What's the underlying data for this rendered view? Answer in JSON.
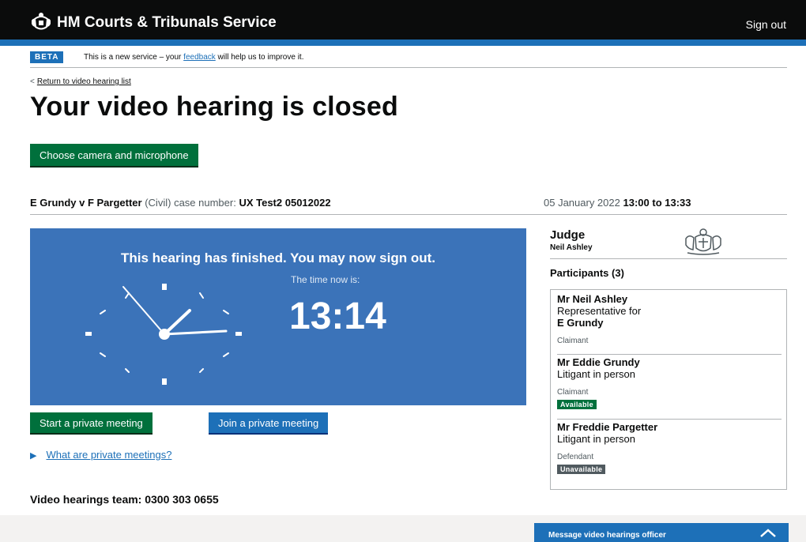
{
  "header": {
    "service_name": "HM Courts & Tribunals Service",
    "sign_out": "Sign out"
  },
  "banner": {
    "tag": "BETA",
    "text_before": "This is a new service – your ",
    "link": "feedback",
    "text_after": " will help us to improve it."
  },
  "nav": {
    "back_link": "Return to video hearing list"
  },
  "page": {
    "title": "Your video hearing is closed",
    "choose_devices_button": "Choose camera and microphone"
  },
  "case": {
    "parties": "E Grundy v F Pargetter",
    "case_type": "(Civil)",
    "case_number_label": "case number:",
    "case_number": "UX Test2 05012022",
    "date": "05 January 2022",
    "start_time": "13:00",
    "to": "to",
    "end_time": "13:33"
  },
  "clock": {
    "finished_message": "This hearing has finished. You may now sign out.",
    "time_label": "The time now is:",
    "time_value": "13:14"
  },
  "actions": {
    "start_private_meeting": "Start a private meeting",
    "join_private_meeting": "Join a private meeting",
    "private_meetings_link": "What are private meetings?"
  },
  "contact": {
    "text": "Video hearings team: 0300 303 0655"
  },
  "judge": {
    "title": "Judge",
    "name": "Neil Ashley"
  },
  "participants": {
    "heading": "Participants (3)",
    "items": [
      {
        "name": "Mr Neil Ashley",
        "role": "Representative for",
        "represents": "E Grundy",
        "type": "Claimant",
        "status": ""
      },
      {
        "name": "Mr Eddie Grundy",
        "role": "Litigant in person",
        "represents": "",
        "type": "Claimant",
        "status": "Available"
      },
      {
        "name": "Mr Freddie Pargetter",
        "role": "Litigant in person",
        "represents": "",
        "type": "Defendant",
        "status": "Unavailable"
      }
    ]
  },
  "messaging": {
    "label": "Message video hearings officer"
  },
  "colors": {
    "header_bg": "#0b0c0c",
    "brand_blue": "#1d70b8",
    "button_green": "#00703c",
    "clock_panel": "#3b73b9",
    "available_tag": "#00703c",
    "unavailable_tag": "#505a5f"
  }
}
